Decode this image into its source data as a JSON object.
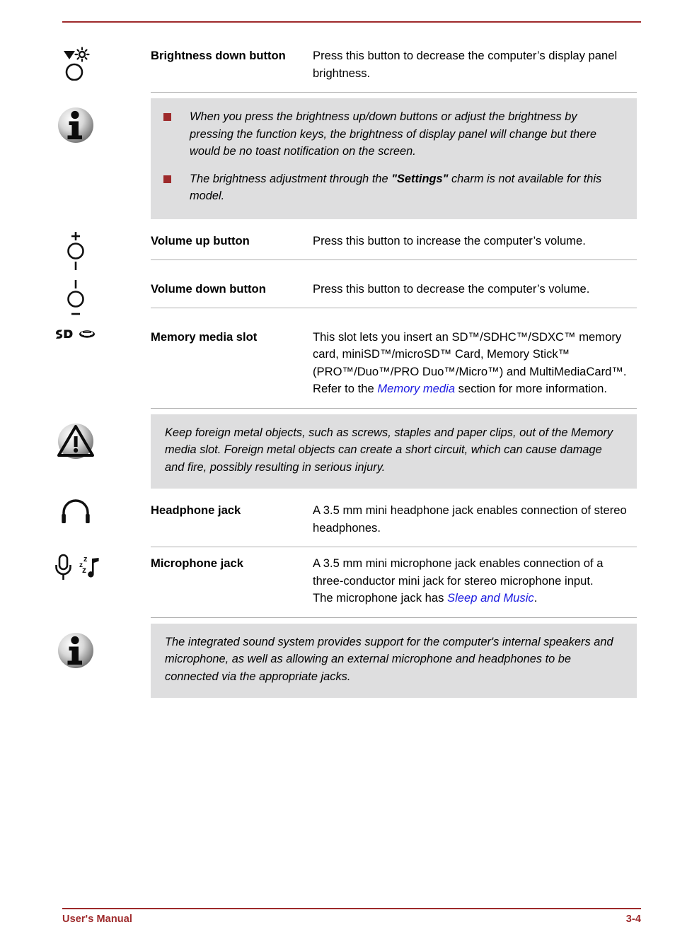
{
  "footer": {
    "manual_label": "User's Manual",
    "page_number": "3-4",
    "accent_color": "#9e2a2b"
  },
  "rows": [
    {
      "icon": "brightness-down-button-icon",
      "name": "Brightness down button",
      "desc_prefix": "Press this button to decrease the computer’s display panel brightness.",
      "desc_link": "",
      "desc_suffix": ""
    },
    {
      "icon": "volume-up-button-icon",
      "name": "Volume up button",
      "desc_prefix": "Press this button to increase the computer’s volume.",
      "desc_link": "",
      "desc_suffix": ""
    },
    {
      "icon": "volume-down-button-icon",
      "name": "Volume down button",
      "desc_prefix": "Press this button to decrease the computer’s volume.",
      "desc_link": "",
      "desc_suffix": ""
    },
    {
      "icon": "memory-media-slot-icon",
      "name": "Memory media slot",
      "desc_prefix": "This slot lets you insert an SD™/SDHC™/SDXC™ memory card, miniSD™/microSD™ Card, Memory Stick™ (PRO™/Duo™/PRO Duo™/Micro™) and MultiMediaCard™. Refer to the ",
      "desc_link": "Memory media",
      "desc_suffix": " section for more information."
    },
    {
      "icon": "headphone-jack-icon",
      "name": "Headphone jack",
      "desc_prefix": "A 3.5 mm mini headphone jack enables connection of stereo headphones.",
      "desc_link": "",
      "desc_suffix": ""
    },
    {
      "icon": "microphone-jack-icon",
      "name": "Microphone jack",
      "desc_prefix": "A 3.5 mm mini microphone jack enables connection of a three-conductor mini jack for stereo microphone input.\nThe microphone jack has ",
      "desc_link": "Sleep and Music",
      "desc_suffix": "."
    }
  ],
  "notes": {
    "brightness_note": {
      "icon": "info-icon",
      "bullets": [
        {
          "text_before": "When you press the brightness up/down buttons or adjust the brightness by pressing the function keys, the brightness of display panel will change but there would be no toast notification on the screen.",
          "emphasis": "",
          "text_after": ""
        },
        {
          "text_before": "The brightness adjustment through the ",
          "emphasis": "\"Settings\"",
          "text_after": " charm is not available for this model."
        }
      ]
    },
    "memory_caution": {
      "icon": "warning-icon",
      "text": "Keep foreign metal objects, such as screws, staples and paper clips, out of the Memory media slot. Foreign metal objects can create a short circuit, which can cause damage and fire, possibly resulting in serious injury."
    },
    "sound_note": {
      "icon": "info-icon",
      "text": "The integrated sound system provides support for the computer's internal speakers and microphone, as well as allowing an external microphone and headphones to be connected via the appropriate jacks."
    }
  }
}
